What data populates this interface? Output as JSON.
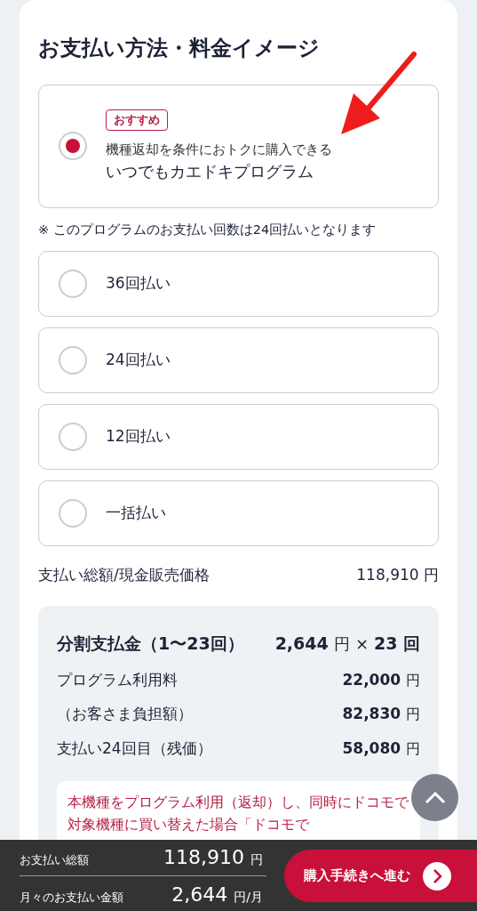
{
  "title": "お支払い方法・料金イメージ",
  "program": {
    "badge": "おすすめ",
    "subtitle": "機種返却を条件におトクに購入できる",
    "label": "いつでもカエドキプログラム",
    "selected": true
  },
  "plan_note": "※ このプログラムのお支払い回数は24回払いとなります",
  "installments": [
    {
      "label": "36回払い",
      "selected": false
    },
    {
      "label": "24回払い",
      "selected": false
    },
    {
      "label": "12回払い",
      "selected": false
    },
    {
      "label": "一括払い",
      "selected": false
    }
  ],
  "total": {
    "label": "支払い総額/現金販売価格",
    "value": "118,910",
    "unit": "円"
  },
  "breakdown": {
    "heading": {
      "label": "分割支払金（1〜23回）",
      "amount": "2,644",
      "unit": "円",
      "times": "×",
      "count": "23",
      "count_unit": "回"
    },
    "rows": [
      {
        "label": "プログラム利用料",
        "value": "22,000",
        "unit": "円"
      },
      {
        "label": "（お客さま負担額）",
        "value": "82,830",
        "unit": "円"
      },
      {
        "label": "支払い24回目（残価）",
        "value": "58,080",
        "unit": "円"
      }
    ],
    "notice": [
      "本機種をプログラム利用（返却）し、同時にドコモで",
      "対象機種に買い替えた場合「ドコモで"
    ]
  },
  "footer": {
    "rows": [
      {
        "label": "お支払い総額",
        "value": "118,910",
        "unit": "円"
      },
      {
        "label": "月々のお支払い金額",
        "value": "2,644",
        "unit": "円/月"
      }
    ],
    "button": "購入手続きへ進む"
  }
}
